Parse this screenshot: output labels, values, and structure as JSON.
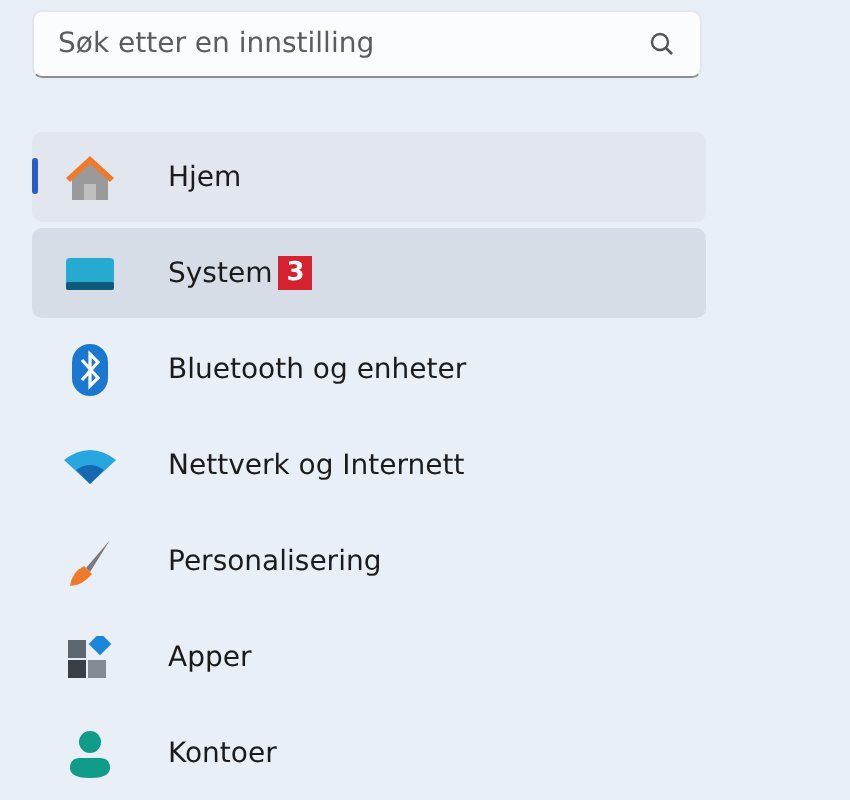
{
  "search": {
    "placeholder": "Søk etter en innstilling"
  },
  "sidebar": {
    "items": [
      {
        "label": "Hjem",
        "selected": true,
        "hovered": false
      },
      {
        "label": "System",
        "selected": false,
        "hovered": true,
        "badge": "3"
      },
      {
        "label": "Bluetooth og enheter",
        "selected": false,
        "hovered": false
      },
      {
        "label": "Nettverk og Internett",
        "selected": false,
        "hovered": false
      },
      {
        "label": "Personalisering",
        "selected": false,
        "hovered": false
      },
      {
        "label": "Apper",
        "selected": false,
        "hovered": false
      },
      {
        "label": "Kontoer",
        "selected": false,
        "hovered": false
      }
    ]
  }
}
